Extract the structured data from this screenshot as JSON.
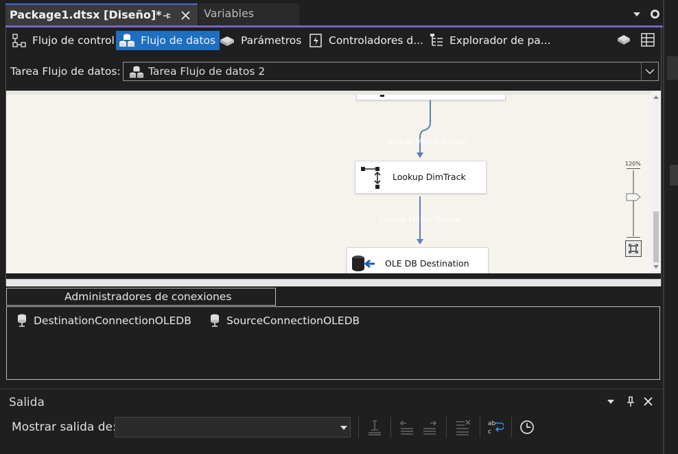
{
  "tabs": {
    "active": "Package1.dtsx [Diseño]*",
    "inactive": "Variables"
  },
  "designer_tabs": [
    {
      "label": "Flujo de control",
      "icon": "control-flow-icon",
      "active": false
    },
    {
      "label": "Flujo de datos",
      "icon": "data-flow-icon",
      "active": true
    },
    {
      "label": "Parámetros",
      "icon": "parameters-icon",
      "active": false
    },
    {
      "label": "Controladores d...",
      "icon": "event-handlers-icon",
      "active": false
    },
    {
      "label": "Explorador de pa...",
      "icon": "package-explorer-icon",
      "active": false
    }
  ],
  "task": {
    "label": "Tarea Flujo de datos:",
    "value": "Tarea Flujo de datos 2"
  },
  "canvas": {
    "nodes": {
      "lookup": "Lookup DimTrack",
      "destination": "OLE DB Destination"
    },
    "paths": {
      "first": "Lookup Match Output",
      "second": "Lookup Match Output"
    },
    "zoom_label": "120%"
  },
  "connections": {
    "tab_label": "Administradores de conexiones",
    "items": [
      "DestinationConnectionOLEDB",
      "SourceConnectionOLEDB"
    ]
  },
  "output": {
    "title": "Salida",
    "show_label": "Mostrar salida de:",
    "show_value": ""
  },
  "colors": {
    "accent": "#1d6fc1",
    "tab_underline": "#7a62c9",
    "canvas_bg": "#f5f3ec",
    "path_line": "#5a7fb0"
  }
}
